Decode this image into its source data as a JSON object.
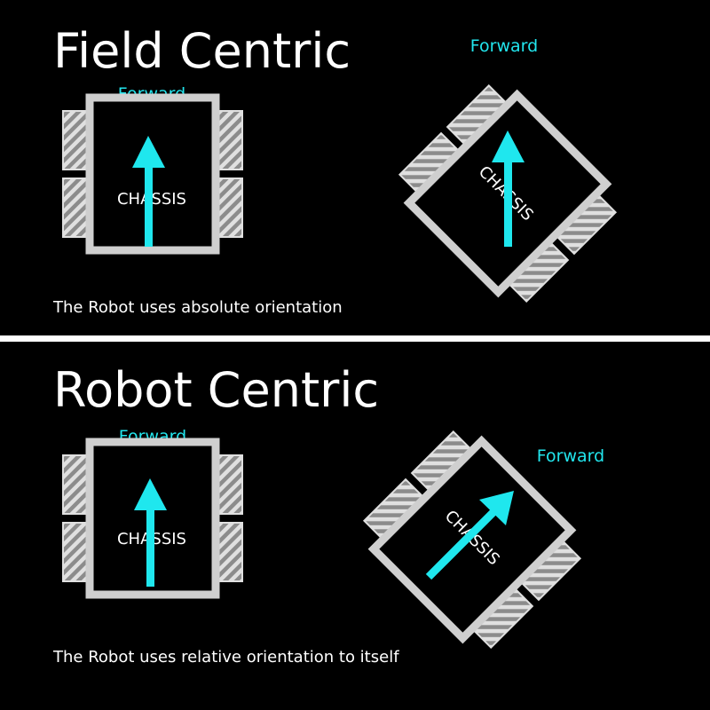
{
  "panels": {
    "field": {
      "title": "Field Centric",
      "caption": "The Robot uses absolute orientation",
      "upright_robot": {
        "forward_label": "Forward",
        "chassis_label": "CHASSIS"
      },
      "rotated_robot": {
        "forward_label": "Forward",
        "chassis_label": "CHASSIS"
      }
    },
    "robot": {
      "title": "Robot Centric",
      "caption": "The Robot uses relative orientation to itself",
      "upright_robot": {
        "forward_label": "Forward",
        "chassis_label": "CHASSIS"
      },
      "rotated_robot": {
        "forward_label": "Forward",
        "chassis_label": "CHASSIS"
      }
    }
  },
  "colors": {
    "background": "#000000",
    "text": "#ffffff",
    "arrow": "#1fe7ee",
    "frame": "#cfcfcf",
    "divider": "#ffffff",
    "wheel": "#8c8c8c"
  },
  "icons": {
    "robot": "robot-chassis-icon",
    "arrow": "forward-arrow-icon",
    "wheel": "wheel-icon"
  }
}
